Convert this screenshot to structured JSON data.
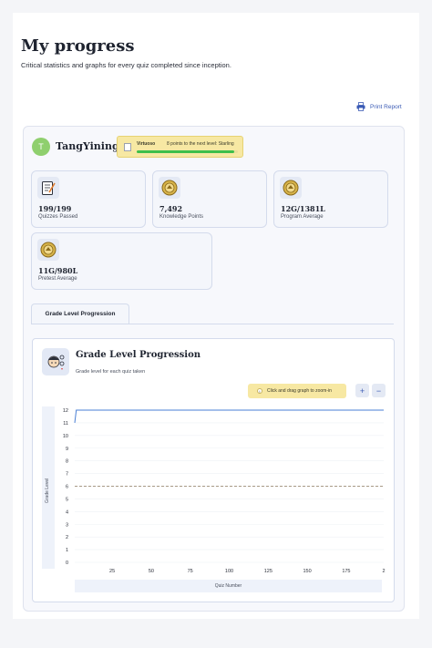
{
  "header": {
    "title": "My progress",
    "subtitle": "Critical statistics and graphs for every quiz completed since inception.",
    "print_label": "Print Report"
  },
  "profile": {
    "initial": "T",
    "name": "TangYining",
    "rank_name": "Virtuoso",
    "rank_next": "8 points to the next level: Starling",
    "rank_progress": 0.96
  },
  "stats": [
    {
      "value": "199/199",
      "label": "Quizzes Passed",
      "icon": "quiz-checklist-icon"
    },
    {
      "value": "7,492",
      "label": "Knowledge Points",
      "icon": "medal-icon"
    },
    {
      "value": "12G/1381L",
      "label": "Program Average",
      "icon": "medal-icon"
    },
    {
      "value": "11G/980L",
      "label": "Pretest Average",
      "icon": "medal-icon"
    }
  ],
  "tabs": [
    {
      "label": "Grade Level Progression"
    }
  ],
  "panel": {
    "title": "Grade Level Progression",
    "subtitle": "Grade level for each quiz taken",
    "zoom_hint": "Click and drag graph to zoom-in",
    "zoom_in": "+",
    "zoom_out": "−"
  },
  "chart_data": {
    "type": "line",
    "xlabel": "Quiz Number",
    "ylabel": "Grade Level",
    "xlim": [
      1,
      199
    ],
    "ylim": [
      0,
      12
    ],
    "x_ticks": [
      "25",
      "50",
      "75",
      "100",
      "125",
      "150",
      "175",
      "2"
    ],
    "y_ticks": [
      "0",
      "1",
      "2",
      "3",
      "4",
      "5",
      "6",
      "7",
      "8",
      "9",
      "10",
      "11",
      "12"
    ],
    "series": [
      {
        "x": [
          1,
          2,
          199
        ],
        "y": [
          11,
          12,
          12
        ],
        "color": "#4a7fd4"
      }
    ],
    "reference_line": {
      "y": 6,
      "style": "dashed",
      "color": "#a89a86"
    },
    "grid": true
  },
  "colors": {
    "accent": "#3b5bb5",
    "rank_bg": "#f7e8a3",
    "rank_fill": "#3fbf4a",
    "avatar": "#8fcf6e"
  }
}
